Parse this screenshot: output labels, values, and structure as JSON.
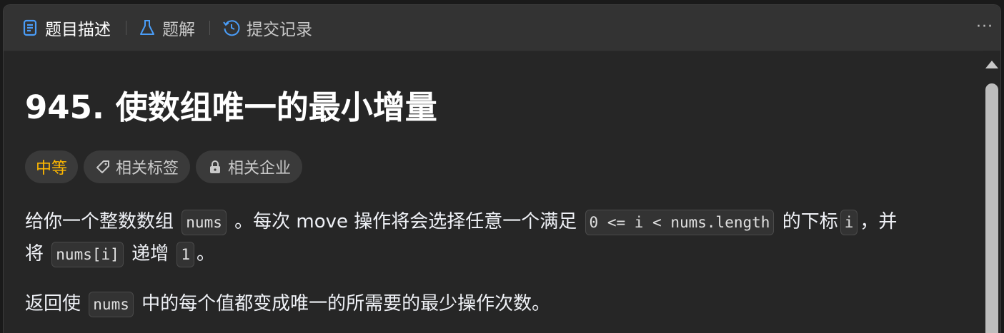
{
  "tabs": [
    {
      "label": "题目描述",
      "icon": "description-icon",
      "active": true
    },
    {
      "label": "题解",
      "icon": "flask-icon",
      "active": false
    },
    {
      "label": "提交记录",
      "icon": "history-icon",
      "active": false
    }
  ],
  "more_label": "···",
  "problem": {
    "title": "945. 使数组唯一的最小增量",
    "difficulty": "中等",
    "tags_label": "相关标签",
    "companies_label": "相关企业"
  },
  "description": {
    "p1": {
      "t1": "给你一个整数数组",
      "c1": "nums",
      "t2": "。每次 move 操作将会选择任意一个满足",
      "c2": "0 <= i < nums.length",
      "t3": "的下标",
      "c3": "i",
      "t4": "，并"
    },
    "p1b": {
      "t1": "将",
      "c1": "nums[i]",
      "t2": "递增",
      "c2": "1",
      "t3": "。"
    },
    "p2": {
      "t1": "返回使",
      "c1": "nums",
      "t2": "中的每个值都变成唯一的所需要的最少操作次数。"
    }
  },
  "colors": {
    "difficulty": "#ffb800",
    "active_tab_icon": "#4a9df8",
    "background": "#262626"
  }
}
